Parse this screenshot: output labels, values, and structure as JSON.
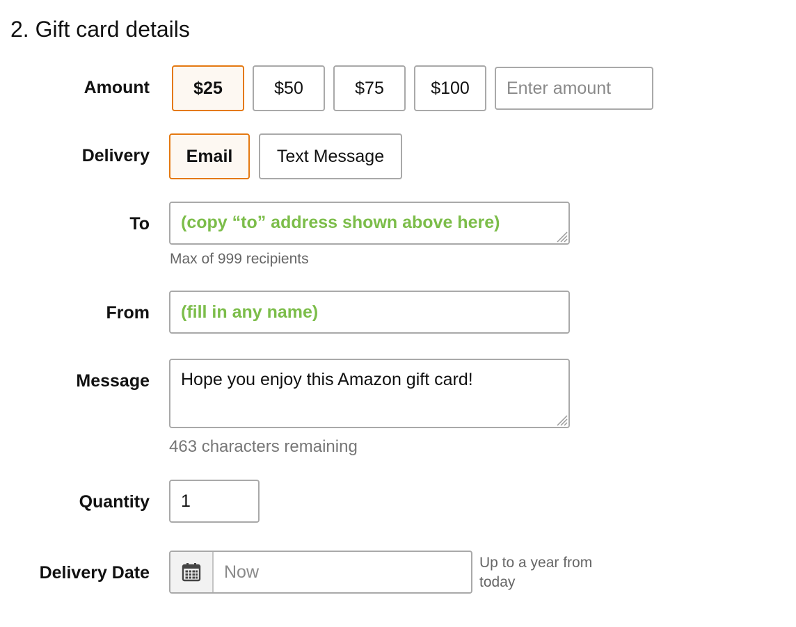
{
  "section": {
    "title": "2. Gift card details"
  },
  "amount": {
    "label": "Amount",
    "options": [
      "$25",
      "$50",
      "$75",
      "$100"
    ],
    "selected": "$25",
    "custom_placeholder": "Enter amount"
  },
  "delivery": {
    "label": "Delivery",
    "options": [
      "Email",
      "Text Message"
    ],
    "selected": "Email"
  },
  "to": {
    "label": "To",
    "value": "(copy “to” address shown above here)",
    "hint": "Max of 999 recipients"
  },
  "from": {
    "label": "From",
    "value": "(fill in any name)"
  },
  "message": {
    "label": "Message",
    "value": "Hope you enjoy this Amazon gift card!",
    "remaining": "463 characters remaining"
  },
  "quantity": {
    "label": "Quantity",
    "value": "1"
  },
  "delivery_date": {
    "label": "Delivery Date",
    "placeholder": "Now",
    "icon": "calendar-icon",
    "note": "Up to a year from today"
  },
  "colors": {
    "selected_border": "#e47911",
    "selected_background": "#fdf8f2",
    "hint_green": "#7cbd4a",
    "border_gray": "#a9a9a9"
  }
}
